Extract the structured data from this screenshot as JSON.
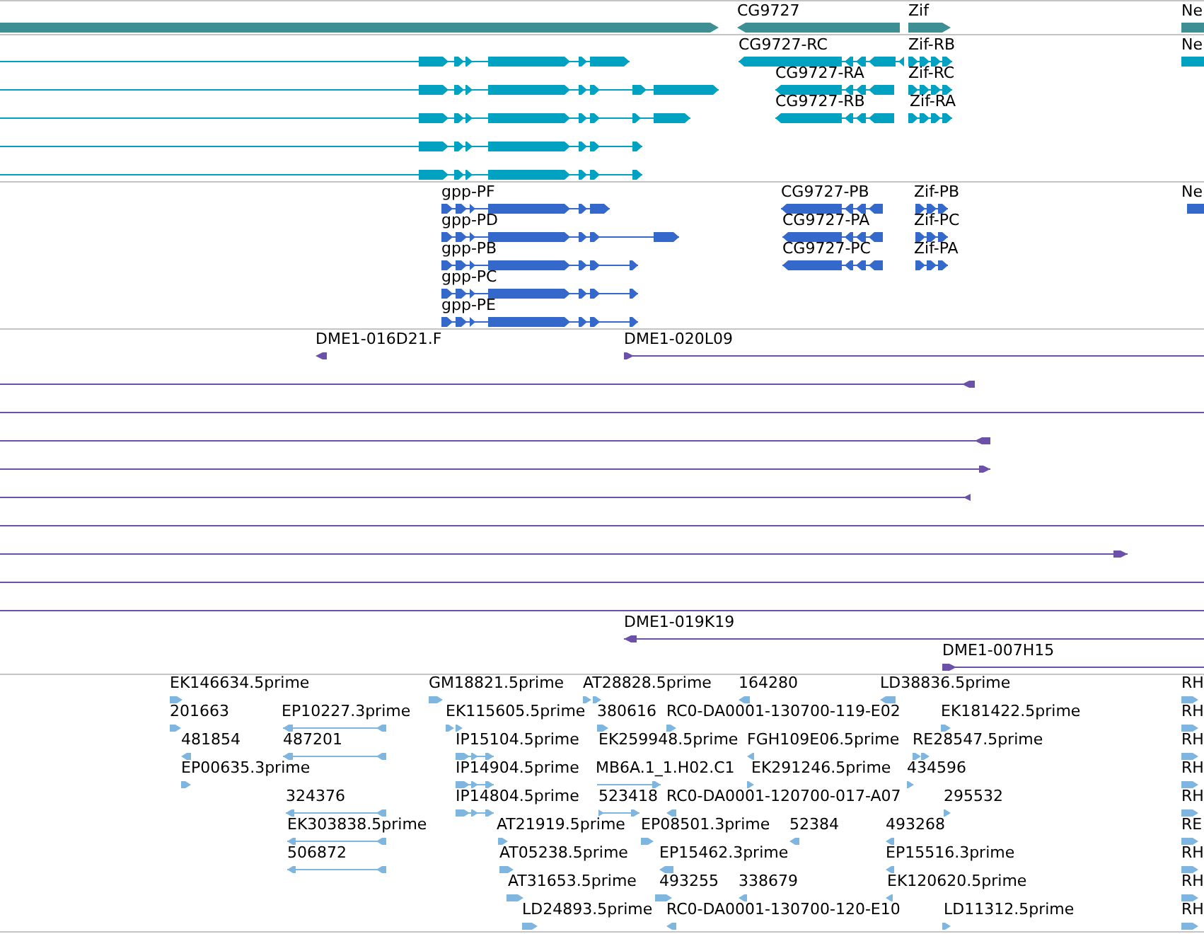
{
  "tracks": [
    {
      "kind": "gene",
      "color": "#3d8f93",
      "rows": [
        {
          "features": [
            {
              "reverse": false
            },
            {
              "label": "CG9727",
              "reverse": true
            },
            {
              "label": "Zif",
              "reverse": false
            },
            {
              "label": "Ne"
            }
          ]
        }
      ]
    },
    {
      "kind": "mrna",
      "color": "#00a1c1",
      "rows": [
        {
          "features": [
            {
              "reverse": false
            },
            {
              "label": "CG9727-RC",
              "reverse": true
            },
            {
              "label": "Zif-RB",
              "reverse": false
            },
            {
              "label": "Ne"
            }
          ]
        },
        {
          "features": [
            {
              "reverse": false
            },
            {
              "label": "CG9727-RA",
              "reverse": true
            },
            {
              "label": "Zif-RC",
              "reverse": false
            }
          ]
        },
        {
          "features": [
            {
              "reverse": false
            },
            {
              "label": "CG9727-RB",
              "reverse": true
            },
            {
              "label": "Zif-RA",
              "reverse": false
            }
          ]
        },
        {
          "features": [
            {
              "reverse": false
            }
          ]
        },
        {
          "features": [
            {
              "reverse": false
            }
          ]
        }
      ]
    },
    {
      "kind": "cds",
      "color": "#3468cb",
      "rows": [
        {
          "features": [
            {
              "label": "gpp-PF",
              "reverse": false
            },
            {
              "label": "CG9727-PB",
              "reverse": true
            },
            {
              "label": "Zif-PB",
              "reverse": false
            },
            {
              "label": "Ne"
            }
          ]
        },
        {
          "features": [
            {
              "label": "gpp-PD",
              "reverse": false
            },
            {
              "label": "CG9727-PA",
              "reverse": true
            },
            {
              "label": "Zif-PC",
              "reverse": false
            }
          ]
        },
        {
          "features": [
            {
              "label": "gpp-PB",
              "reverse": false
            },
            {
              "label": "CG9727-PC",
              "reverse": true
            },
            {
              "label": "Zif-PA",
              "reverse": false
            }
          ]
        },
        {
          "features": [
            {
              "label": "gpp-PC",
              "reverse": false
            }
          ]
        },
        {
          "features": [
            {
              "label": "gpp-PE",
              "reverse": false
            }
          ]
        }
      ]
    },
    {
      "kind": "bac",
      "color": "#6b52a8",
      "rows": [
        {
          "features": [
            {
              "kind": "end",
              "label": "DME1-016D21.F",
              "reverse": true
            },
            {
              "kind": "end",
              "label": "DME1-020L09",
              "reverse": false
            }
          ]
        },
        {
          "features": [
            {
              "kind": "end",
              "reverse": true
            }
          ]
        },
        {
          "features": [
            {
              "kind": "span"
            }
          ]
        },
        {
          "features": [
            {
              "kind": "end",
              "reverse": true
            }
          ]
        },
        {
          "features": [
            {
              "kind": "end",
              "reverse": false
            }
          ]
        },
        {
          "features": [
            {
              "kind": "end",
              "reverse": true
            }
          ]
        },
        {
          "features": [
            {
              "kind": "span"
            }
          ]
        },
        {
          "features": [
            {
              "kind": "end",
              "reverse": false
            }
          ]
        },
        {
          "features": [
            {
              "kind": "span"
            }
          ]
        },
        {
          "features": [
            {
              "kind": "span"
            }
          ]
        },
        {
          "features": [
            {
              "kind": "end",
              "label": "DME1-019K19",
              "reverse": true
            }
          ]
        },
        {
          "features": [
            {
              "kind": "end",
              "label": "DME1-007H15",
              "reverse": false
            }
          ]
        }
      ]
    },
    {
      "kind": "est",
      "color": "#7fb6df",
      "rows": [
        {
          "features": [
            {
              "label": "EK146634.5prime",
              "reverse": false
            },
            {
              "label": "GM18821.5prime",
              "reverse": false
            },
            {
              "label": "AT28828.5prime",
              "reverse": false
            },
            {
              "label": "164280",
              "reverse": true
            },
            {
              "label": "LD38836.5prime",
              "reverse": true
            },
            {
              "label": "RH",
              "reverse": false
            }
          ]
        },
        {
          "features": [
            {
              "label": "201663",
              "reverse": false
            },
            {
              "label": "EP10227.3prime",
              "reverse": true
            },
            {
              "label": "EK115605.5prime",
              "reverse": false
            },
            {
              "label": "380616",
              "reverse": false
            },
            {
              "label": "RC0-DA0001-130700-119-E02",
              "reverse": false
            },
            {
              "label": "EK181422.5prime",
              "reverse": false
            },
            {
              "label": "RH",
              "reverse": false
            }
          ]
        },
        {
          "features": [
            {
              "label": "481854",
              "reverse": true
            },
            {
              "label": "487201",
              "reverse": true
            },
            {
              "label": "IP15104.5prime",
              "reverse": false
            },
            {
              "label": "EK259948.5prime"
            },
            {
              "label": "FGH109E06.5prime",
              "reverse": true
            },
            {
              "label": "RE28547.5prime",
              "reverse": false
            },
            {
              "label": "RH",
              "reverse": false
            }
          ]
        },
        {
          "features": [
            {
              "label": "EP00635.3prime",
              "reverse": false
            },
            {
              "label": "IP14904.5prime",
              "reverse": false
            },
            {
              "label": "MB6A.1_1.H02.C1",
              "reverse": false
            },
            {
              "label": "EK291246.5prime",
              "reverse": false
            },
            {
              "label": "434596",
              "reverse": false
            },
            {
              "label": "RH",
              "reverse": false
            }
          ]
        },
        {
          "features": [
            {
              "label": "324376",
              "reverse": true
            },
            {
              "label": "IP14804.5prime",
              "reverse": false
            },
            {
              "label": "523418",
              "reverse": false
            },
            {
              "label": "RC0-DA0001-120700-017-A07",
              "reverse": true
            },
            {
              "label": "295532",
              "reverse": false
            },
            {
              "label": "RH",
              "reverse": false
            }
          ]
        },
        {
          "features": [
            {
              "label": "EK303838.5prime",
              "reverse": true
            },
            {
              "label": "AT21919.5prime",
              "reverse": false
            },
            {
              "label": "EP08501.3prime",
              "reverse": false
            },
            {
              "label": "52384",
              "reverse": true
            },
            {
              "label": "493268",
              "reverse": true
            },
            {
              "label": "RE",
              "reverse": false
            }
          ]
        },
        {
          "features": [
            {
              "label": "506872",
              "reverse": true
            },
            {
              "label": "AT05238.5prime",
              "reverse": false
            },
            {
              "label": "EP15462.3prime",
              "reverse": true
            },
            {
              "label": "EP15516.3prime",
              "reverse": true
            },
            {
              "label": "RH",
              "reverse": false
            }
          ]
        },
        {
          "features": [
            {
              "label": "AT31653.5prime",
              "reverse": false
            },
            {
              "label": "493255",
              "reverse": false
            },
            {
              "label": "338679",
              "reverse": true
            },
            {
              "label": "EK120620.5prime",
              "reverse": true
            },
            {
              "label": "RH",
              "reverse": false
            }
          ]
        },
        {
          "features": [
            {
              "label": "LD24893.5prime",
              "reverse": false
            },
            {
              "label": "RC0-DA0001-130700-120-E10",
              "reverse": true
            },
            {
              "label": "LD11312.5prime",
              "reverse": false
            },
            {
              "label": "RH",
              "reverse": false
            }
          ]
        }
      ]
    }
  ]
}
